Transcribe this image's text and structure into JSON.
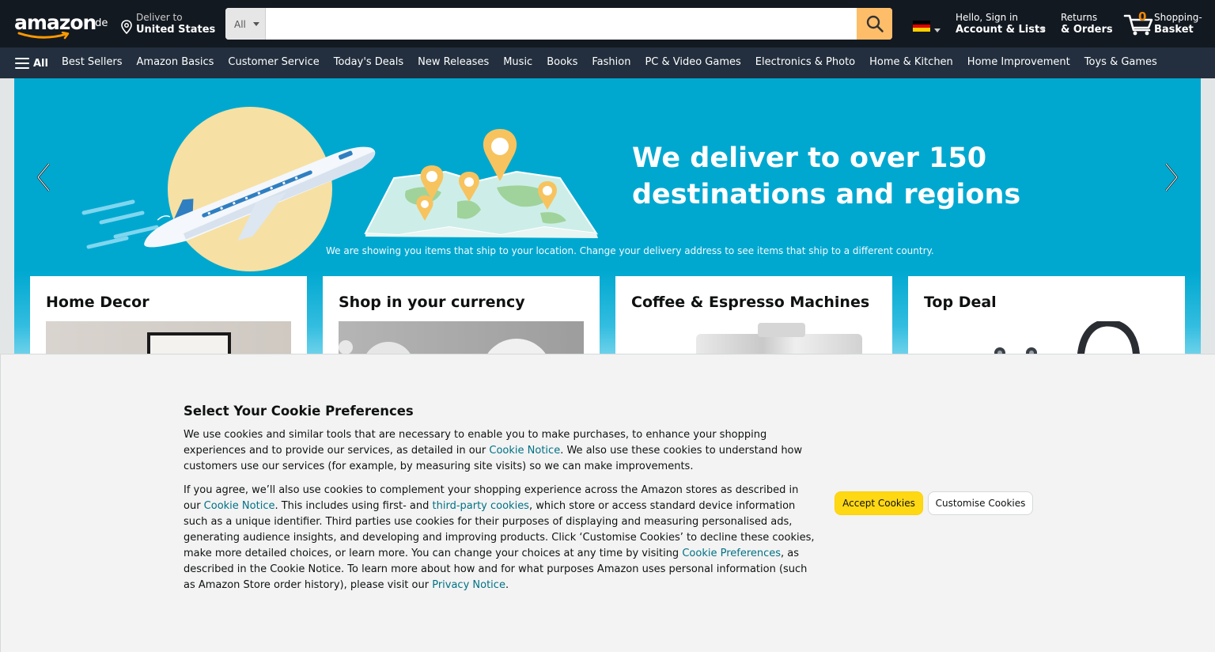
{
  "header": {
    "logo_text": "amazon",
    "logo_tld": ".de",
    "deliver": {
      "small": "Deliver to",
      "location": "United States"
    },
    "search": {
      "dept": "All",
      "placeholder": "",
      "value": ""
    },
    "language_flag": "germany-flag",
    "account": {
      "greeting": "Hello, Sign in",
      "label": "Account & Lists"
    },
    "returns": {
      "line1": "Returns",
      "line2": "& Orders"
    },
    "cart": {
      "count": "0",
      "line1": "Shopping-",
      "line2": "Basket"
    }
  },
  "subnav": {
    "all_label": "All",
    "links": [
      "Best Sellers",
      "Amazon Basics",
      "Customer Service",
      "Today's Deals",
      "New Releases",
      "Music",
      "Books",
      "Fashion",
      "PC & Video Games",
      "Electronics & Photo",
      "Home & Kitchen",
      "Home Improvement",
      "Toys & Games"
    ]
  },
  "hero": {
    "headline_1": "We deliver to over 150",
    "headline_2": "destinations and regions",
    "note": "We are showing you items that ship to your location. Change your delivery address to see items that ship to a different country.",
    "colors": {
      "background": "#00a8d0",
      "sun": "#f6e0a4",
      "pins": "#f7c35f",
      "map": "#cdeee8"
    }
  },
  "cards": [
    {
      "title": "Home Decor"
    },
    {
      "title": "Shop in your currency"
    },
    {
      "title": "Coffee & Espresso Machines"
    },
    {
      "title": "Top Deal"
    }
  ],
  "cookie": {
    "title": "Select Your Cookie Preferences",
    "p1_a": "We use cookies and similar tools that are necessary to enable you to make purchases, to enhance your shopping experiences and to provide our services, as detailed in our ",
    "p1_link": "Cookie Notice",
    "p1_b": ". We also use these cookies to understand how customers use our services (for example, by measuring site visits) so we can make improvements.",
    "p2_a": "If you agree, we’ll also use cookies to complement your shopping experience across the Amazon stores as described in our ",
    "p2_link1": "Cookie Notice",
    "p2_b": ". This includes using first- and ",
    "p2_link2": "third-party cookies",
    "p2_c": ", which store or access standard device information such as a unique identifier. Third parties use cookies for their purposes of displaying and measuring personalised ads, generating audience insights, and developing and improving products. Click ‘Customise Cookies’ to decline these cookies, make more detailed choices, or learn more. You can change your choices at any time by visiting ",
    "p2_link3": "Cookie Preferences",
    "p2_d": ", as described in the Cookie Notice. To learn more about how and for what purposes Amazon uses personal information (such as Amazon Store order history), please visit our ",
    "p2_link4": "Privacy Notice",
    "p2_e": ".",
    "accept_label": "Accept Cookies",
    "customise_label": "Customise Cookies"
  },
  "colors": {
    "nav_dark": "#131921",
    "nav_sub": "#232f3e",
    "search_button": "#febd69",
    "accept": "#ffd814",
    "link": "#007185",
    "cart_count": "#f08804"
  }
}
